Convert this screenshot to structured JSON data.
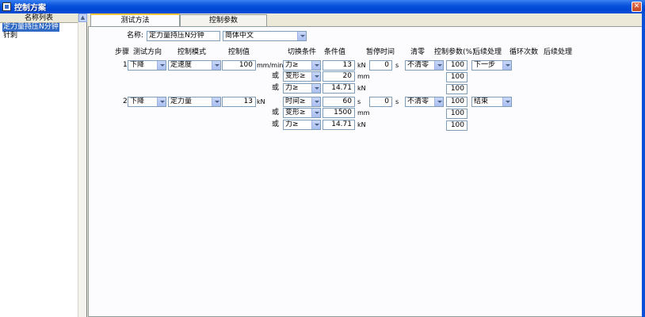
{
  "window": {
    "title": "控制方案"
  },
  "name_list": {
    "header": "名称列表",
    "items": [
      {
        "label": "定力量持压N分钟",
        "selected": true
      },
      {
        "label": "针刺",
        "selected": false
      }
    ]
  },
  "tabs": [
    {
      "label": "测试方法",
      "active": true
    },
    {
      "label": "控制参数",
      "active": false
    }
  ],
  "form": {
    "name_label": "名称:",
    "name_value": "定力量持压N分钟",
    "language": "简体中文"
  },
  "columns": [
    "步骤",
    "测试方向",
    "控制模式",
    "控制值",
    "切换条件",
    "条件值",
    "暂停时间",
    "清零",
    "控制参数(%)",
    "后续处理",
    "循环次数",
    "后续处理"
  ],
  "steps": [
    {
      "no": "1",
      "direction": "下降",
      "mode": "定速度",
      "value": "100",
      "unit": "mm/min",
      "conditions": [
        {
          "conj": "",
          "cond": "力≥",
          "value": "13",
          "unit": "kN"
        },
        {
          "conj": "或",
          "cond": "变形≥",
          "value": "20",
          "unit": "mm"
        },
        {
          "conj": "或",
          "cond": "力≥",
          "value": "14.71",
          "unit": "kN"
        }
      ],
      "pause": "0",
      "pause_unit": "s",
      "zero": "不清零",
      "params": [
        "100",
        "100",
        "100"
      ],
      "follow": "下一步"
    },
    {
      "no": "2",
      "direction": "下降",
      "mode": "定力量",
      "value": "13",
      "unit": "kN",
      "conditions": [
        {
          "conj": "",
          "cond": "时间≥",
          "value": "60",
          "unit": "s"
        },
        {
          "conj": "或",
          "cond": "变形≥",
          "value": "1500",
          "unit": "mm"
        },
        {
          "conj": "或",
          "cond": "力≥",
          "value": "14.71",
          "unit": "kN"
        }
      ],
      "pause": "0",
      "pause_unit": "s",
      "zero": "不清零",
      "params": [
        "100",
        "100",
        "100"
      ],
      "follow": "结束"
    }
  ]
}
